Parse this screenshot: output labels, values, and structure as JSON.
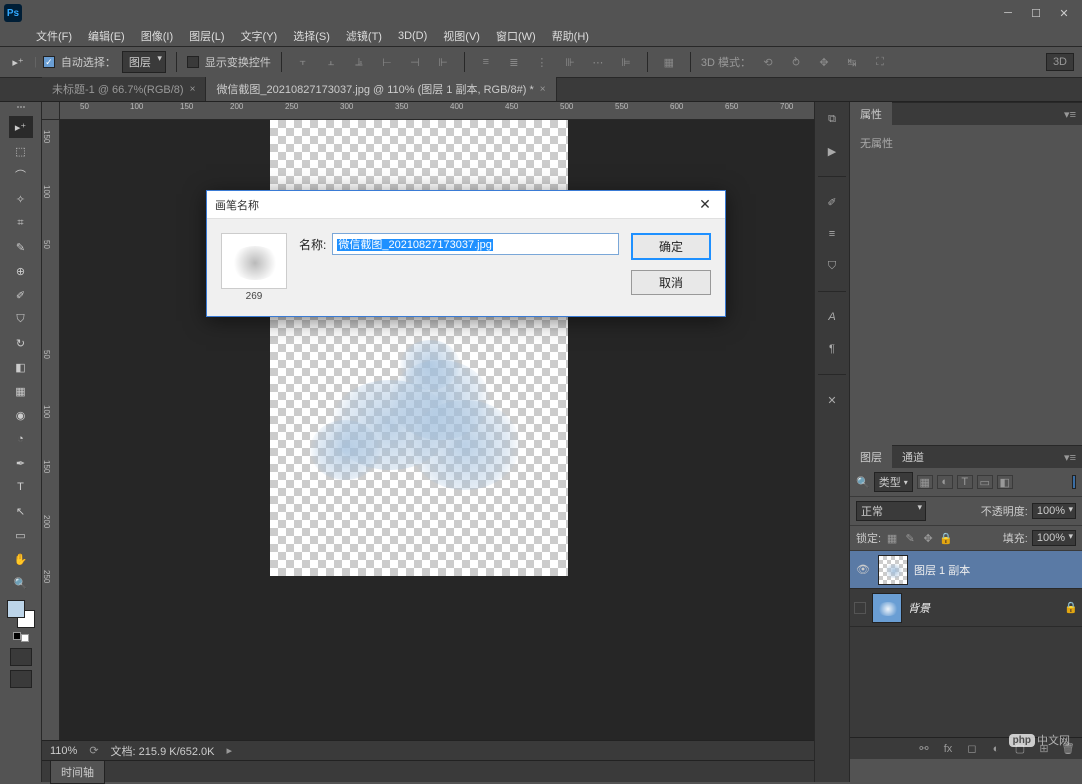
{
  "menu": [
    "文件(F)",
    "编辑(E)",
    "图像(I)",
    "图层(L)",
    "文字(Y)",
    "选择(S)",
    "滤镜(T)",
    "3D(D)",
    "视图(V)",
    "窗口(W)",
    "帮助(H)"
  ],
  "options": {
    "auto_select": "自动选择：",
    "target": "图层",
    "show_transform": "显示变换控件",
    "mode_3d": "3D 模式：",
    "btn_3d": "3D"
  },
  "tabs": [
    {
      "title": "未标题-1 @ 66.7%(RGB/8)",
      "close": "×",
      "active": false
    },
    {
      "title": "微信截图_20210827173037.jpg @ 110% (图层 1 副本, RGB/8#) *",
      "close": "×",
      "active": true
    }
  ],
  "ruler_h": [
    "50",
    "100",
    "150",
    "200",
    "250",
    "300",
    "350",
    "400",
    "450",
    "500",
    "550",
    "600",
    "650",
    "700"
  ],
  "ruler_v": [
    "150",
    "100",
    "50",
    "50",
    "100",
    "150",
    "200",
    "250"
  ],
  "status": {
    "zoom": "110%",
    "doc_label": "文档:",
    "doc_val": "215.9 K/652.0K"
  },
  "timeline": {
    "tab": "时间轴"
  },
  "panels": {
    "properties": {
      "tab": "属性",
      "body": "无属性"
    },
    "layers": {
      "tabs": [
        "图层",
        "通道"
      ],
      "filter_label": "类型",
      "blend_mode": "正常",
      "opacity_label": "不透明度:",
      "opacity_val": "100%",
      "lock_label": "锁定:",
      "fill_label": "填充:",
      "fill_val": "100%",
      "rows": [
        {
          "name": "图层 1 副本",
          "visible": true,
          "selected": true,
          "italic": false,
          "locked": false
        },
        {
          "name": "背景",
          "visible": false,
          "selected": false,
          "italic": true,
          "locked": true
        }
      ]
    }
  },
  "dialog": {
    "title": "画笔名称",
    "thumb_num": "269",
    "name_label": "名称:",
    "name_value": "微信截图_20210827173037.jpg",
    "ok": "确定",
    "cancel": "取消"
  },
  "watermark": {
    "logo": "php",
    "text": "中文网"
  }
}
